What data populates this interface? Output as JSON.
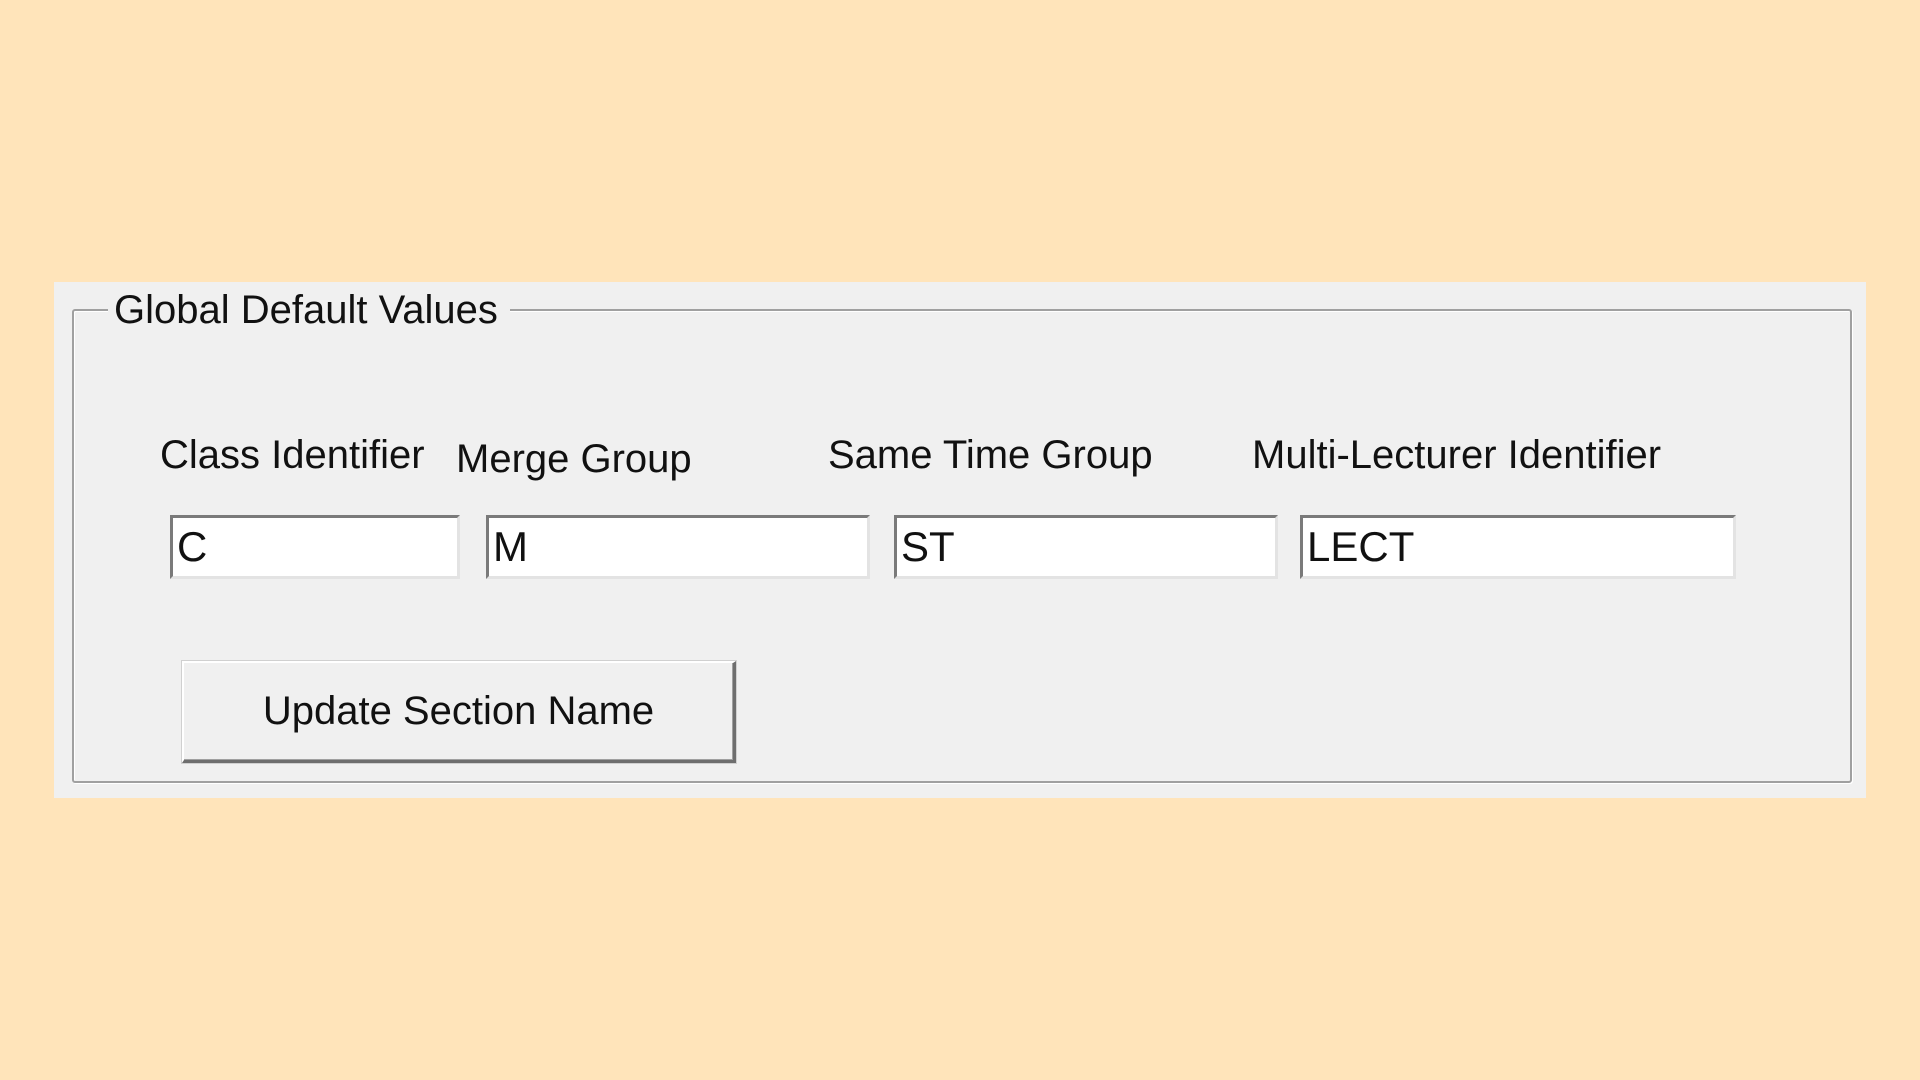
{
  "group": {
    "title": "Global Default Values"
  },
  "fields": [
    {
      "label": "Class Identifier",
      "value": "C"
    },
    {
      "label": "Merge Group",
      "value": "M"
    },
    {
      "label": "Same Time Group",
      "value": "ST"
    },
    {
      "label": "Multi-Lecturer Identifier",
      "value": "LECT"
    }
  ],
  "actions": {
    "update_label": "Update Section Name"
  },
  "colors": {
    "background": "#FFE4BA",
    "panel": "#F0F0F0",
    "border": "#A0A0A0"
  }
}
